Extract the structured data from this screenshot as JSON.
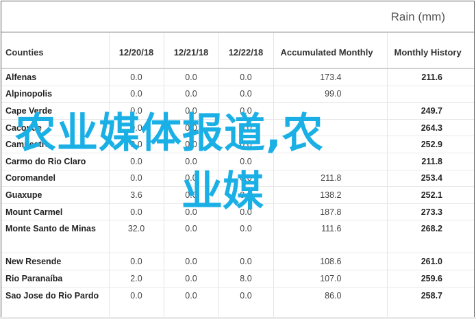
{
  "header": {
    "title": "Rain (mm)"
  },
  "table": {
    "columns": [
      "Counties",
      "12/20/18",
      "12/21/18",
      "12/22/18",
      "Accumulated Monthly",
      "Monthly History"
    ],
    "rows": [
      {
        "county": "Alfenas",
        "d1": "0.0",
        "d2": "0.0",
        "d3": "0.0",
        "acc": "173.4",
        "hist": "211.6"
      },
      {
        "county": "Alpinopolis",
        "d1": "0.0",
        "d2": "0.0",
        "d3": "0.0",
        "acc": "99.0",
        "hist": ""
      },
      {
        "county": "Cape Verde",
        "d1": "0.0",
        "d2": "0.0",
        "d3": "0.0",
        "acc": "",
        "hist": "249.7"
      },
      {
        "county": "Caconde",
        "d1": "0.0",
        "d2": "0.0",
        "d3": "0.0",
        "acc": "",
        "hist": "264.3"
      },
      {
        "county": "Campestre",
        "d1": "0.0",
        "d2": "0.0",
        "d3": "0.0",
        "acc": "",
        "hist": "252.9"
      },
      {
        "county": "Carmo do Rio Claro",
        "d1": "0.0",
        "d2": "0.0",
        "d3": "0.0",
        "acc": "",
        "hist": "211.8"
      },
      {
        "county": "Coromandel",
        "d1": "0.0",
        "d2": "0.0",
        "d3": "0.0",
        "acc": "211.8",
        "hist": "253.4"
      },
      {
        "county": "Guaxupe",
        "d1": "3.6",
        "d2": "0.0",
        "d3": "0.0",
        "acc": "138.2",
        "hist": "252.1"
      },
      {
        "county": "Mount Carmel",
        "d1": "0.0",
        "d2": "0.0",
        "d3": "0.0",
        "acc": "187.8",
        "hist": "273.3"
      },
      {
        "county": "Monte Santo de Minas",
        "d1": "32.0",
        "d2": "0.0",
        "d3": "0.0",
        "acc": "111.6",
        "hist": "268.2"
      },
      {
        "county": "New Resende",
        "d1": "0.0",
        "d2": "0.0",
        "d3": "0.0",
        "acc": "108.6",
        "hist": "261.0"
      },
      {
        "county": "Rio Paranaíba",
        "d1": "2.0",
        "d2": "0.0",
        "d3": "8.0",
        "acc": "107.0",
        "hist": "259.6"
      },
      {
        "county": "Sao Jose do Rio Pardo",
        "d1": "0.0",
        "d2": "0.0",
        "d3": "0.0",
        "acc": "86.0",
        "hist": "258.7"
      }
    ]
  },
  "overlay": {
    "line1": "农业媒体报道,农",
    "line2": "业媒"
  },
  "colors": {
    "overlay_text": "#1ab0e6",
    "border": "#5a5a5a"
  }
}
